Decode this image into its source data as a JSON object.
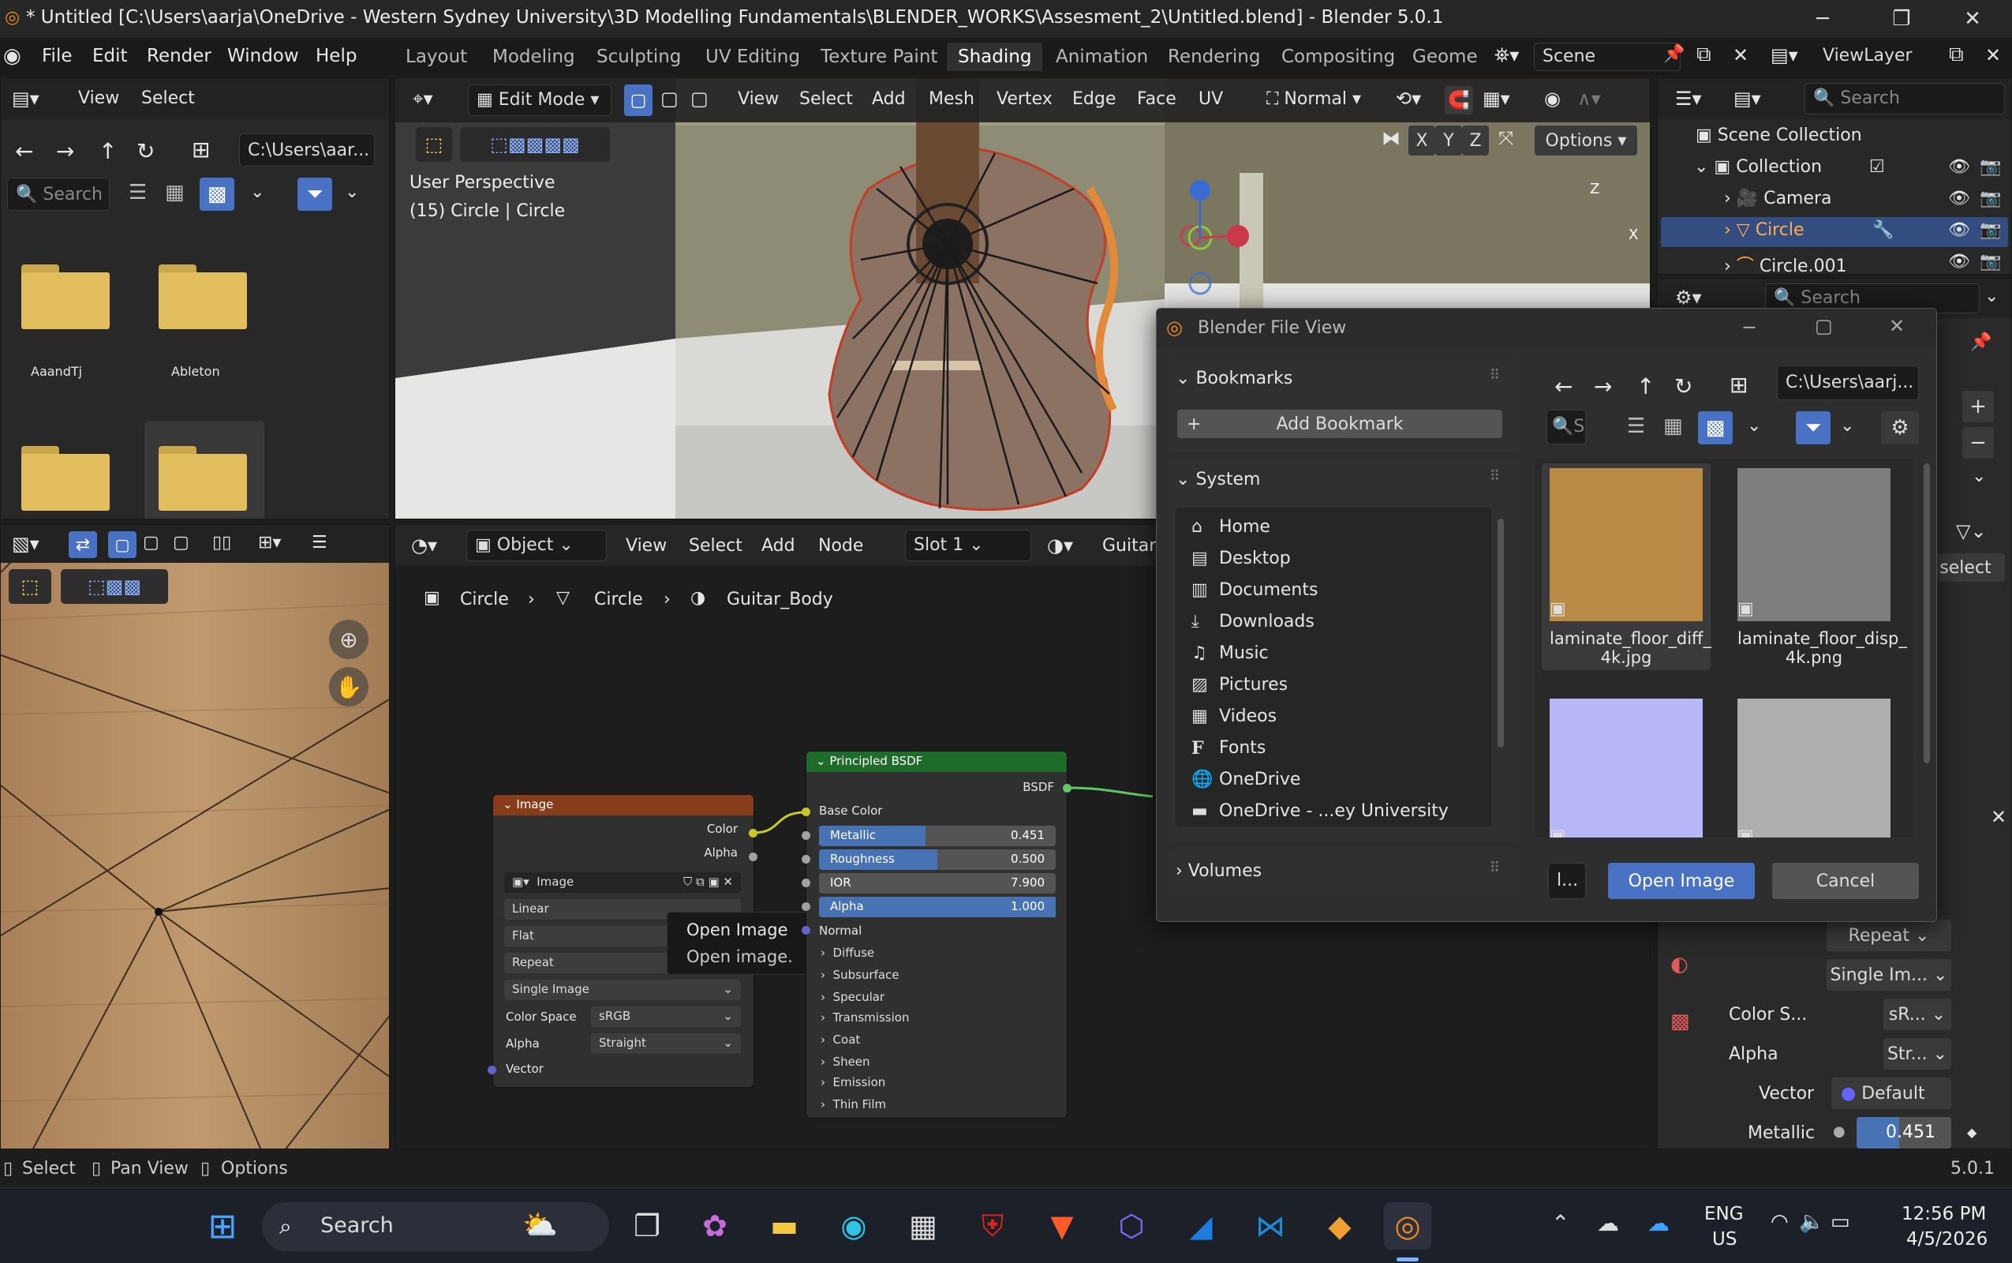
{
  "window": {
    "title": "* Untitled [C:\\Users\\aarja\\OneDrive - Western Sydney University\\3D Modelling Fundamentals\\BLENDER_WORKS\\Assesment_2\\Untitled.blend] - Blender 5.0.1"
  },
  "menu": [
    "File",
    "Edit",
    "Render",
    "Window",
    "Help"
  ],
  "workspaces": [
    "Layout",
    "Modeling",
    "Sculpting",
    "UV Editing",
    "Texture Paint",
    "Shading",
    "Animation",
    "Rendering",
    "Compositing",
    "Geome"
  ],
  "scene": "Scene",
  "view_layer": "ViewLayer",
  "file_browser": {
    "view": "View",
    "select": "Select",
    "path": "C:\\Users\\aar...",
    "search_placeholder": "Search",
    "folders": [
      "AaandTj",
      "Ableton"
    ]
  },
  "viewport": {
    "mode": "Edit Mode",
    "menus": [
      "View",
      "Select",
      "Add",
      "Mesh",
      "Vertex",
      "Edge",
      "Face",
      "UV"
    ],
    "orientation": "Normal",
    "info1": "User Perspective",
    "info2": "(15) Circle | Circle",
    "options": "Options",
    "axes": [
      "X",
      "Y",
      "Z"
    ]
  },
  "outliner": {
    "search": "Search",
    "scene_collection": "Scene Collection",
    "items": [
      "Collection",
      "Camera",
      "Circle",
      "Circle.001"
    ]
  },
  "node_editor": {
    "object": "Object",
    "menus": [
      "View",
      "Select",
      "Add",
      "Node"
    ],
    "slot": "Slot 1",
    "material": "Guitar_",
    "breadcrumb": [
      "Circle",
      "Circle",
      "Guitar_Body"
    ]
  },
  "image_node": {
    "title": "Image",
    "out_color": "Color",
    "out_alpha": "Alpha",
    "image": "Image",
    "interp": "Linear",
    "proj": "Flat",
    "ext": "Repeat",
    "source": "Single Image",
    "cs_label": "Color Space",
    "cs": "sRGB",
    "alpha_label": "Alpha",
    "alpha": "Straight",
    "vector": "Vector"
  },
  "tooltip": {
    "l1": "Open Image",
    "l2": "Open image."
  },
  "bsdf": {
    "title": "Principled BSDF",
    "out": "BSDF",
    "base": "Base Color",
    "sliders": [
      {
        "l": "Metallic",
        "v": "0.451",
        "f": 0.451
      },
      {
        "l": "Roughness",
        "v": "0.500",
        "f": 0.5
      },
      {
        "l": "IOR",
        "v": "7.900",
        "f": 0
      },
      {
        "l": "Alpha",
        "v": "1.000",
        "f": 1
      }
    ],
    "normal": "Normal",
    "subs": [
      "Diffuse",
      "Subsurface",
      "Specular",
      "Transmission",
      "Coat",
      "Sheen",
      "Emission",
      "Thin Film"
    ]
  },
  "dialog": {
    "title": "Blender File View",
    "bookmarks": "Bookmarks",
    "add_bookmark": "Add Bookmark",
    "system": "System",
    "system_items": [
      "Home",
      "Desktop",
      "Documents",
      "Downloads",
      "Music",
      "Pictures",
      "Videos",
      "Fonts",
      "OneDrive",
      "OneDrive - ...ey University"
    ],
    "volumes": "Volumes",
    "path": "C:\\Users\\aarj...",
    "search": "S",
    "files": [
      {
        "name": "laminate_floor_diff_\n4k.jpg",
        "color": "#b98a45"
      },
      {
        "name": "laminate_floor_disp_\n4k.png",
        "color": "#7e7e7e"
      },
      {
        "name": "",
        "color": "#b7b6f6"
      },
      {
        "name": "",
        "color": "#aeaeae"
      }
    ],
    "filename": "l...",
    "open": "Open Image",
    "cancel": "Cancel"
  },
  "props": {
    "search": "Search",
    "select": "select",
    "repeat": "Repeat",
    "single": "Single Im...",
    "cs_label": "Color S...",
    "cs": "sR...",
    "alpha_label": "Alpha",
    "alpha": "Str...",
    "vector_label": "Vector",
    "vector": "Default",
    "metallic_label": "Metallic",
    "metallic": "0.451"
  },
  "statusbar": {
    "select": "Select",
    "pan": "Pan View",
    "options": "Options",
    "version": "5.0.1"
  },
  "taskbar": {
    "search": "Search",
    "lang1": "ENG",
    "lang2": "US",
    "time": "12:56 PM",
    "date": "4/5/2026"
  }
}
